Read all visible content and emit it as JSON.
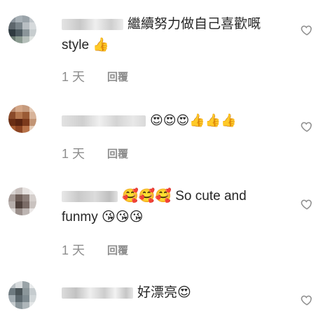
{
  "comments": [
    {
      "text": "繼續努力做自己喜歡嘅",
      "text2": "style 👍",
      "time": "1 天",
      "reply": "回覆"
    },
    {
      "text": "😍😍😍👍👍👍",
      "time": "1 天",
      "reply": "回覆"
    },
    {
      "text": "🥰🥰🥰 So cute and",
      "text2": "funmy 😘😘😘",
      "time": "1 天",
      "reply": "回覆"
    },
    {
      "text": "好漂亮😍"
    }
  ],
  "icons": {
    "like": "heart-outline-icon"
  },
  "colors": {
    "meta": "#8e8e8e",
    "text": "#262626"
  }
}
